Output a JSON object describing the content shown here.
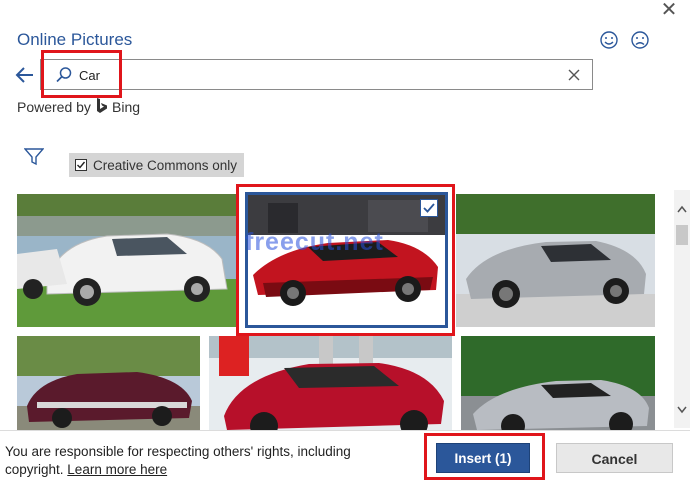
{
  "dialog": {
    "title": "Online Pictures",
    "close_glyph": "✕"
  },
  "feedback": {
    "happy_icon": "smile-icon",
    "sad_icon": "frown-icon"
  },
  "search": {
    "query": "Car",
    "back_icon": "back-arrow-icon",
    "search_icon": "search-icon",
    "clear_icon": "clear-icon"
  },
  "powered": {
    "label": "Powered by",
    "brand": "Bing"
  },
  "filters": {
    "filter_icon": "filter-icon",
    "creative_commons_label": "Creative Commons only",
    "creative_commons_checked": true
  },
  "results": [
    {
      "id": "white-sedan",
      "selected": false
    },
    {
      "id": "red-sports-car",
      "selected": true
    },
    {
      "id": "silver-coupe",
      "selected": false
    },
    {
      "id": "vintage-maroon-car",
      "selected": false
    },
    {
      "id": "red-tesla",
      "selected": false
    },
    {
      "id": "silver-roadster",
      "selected": false
    }
  ],
  "watermark": "freecut.net",
  "footer": {
    "notice_text": "You are responsible for respecting others' rights, including copyright.",
    "learn_more_label": "Learn more here",
    "insert_label": "Insert (1)",
    "cancel_label": "Cancel"
  },
  "colors": {
    "accent": "#2b579a",
    "highlight": "#e0151b"
  }
}
